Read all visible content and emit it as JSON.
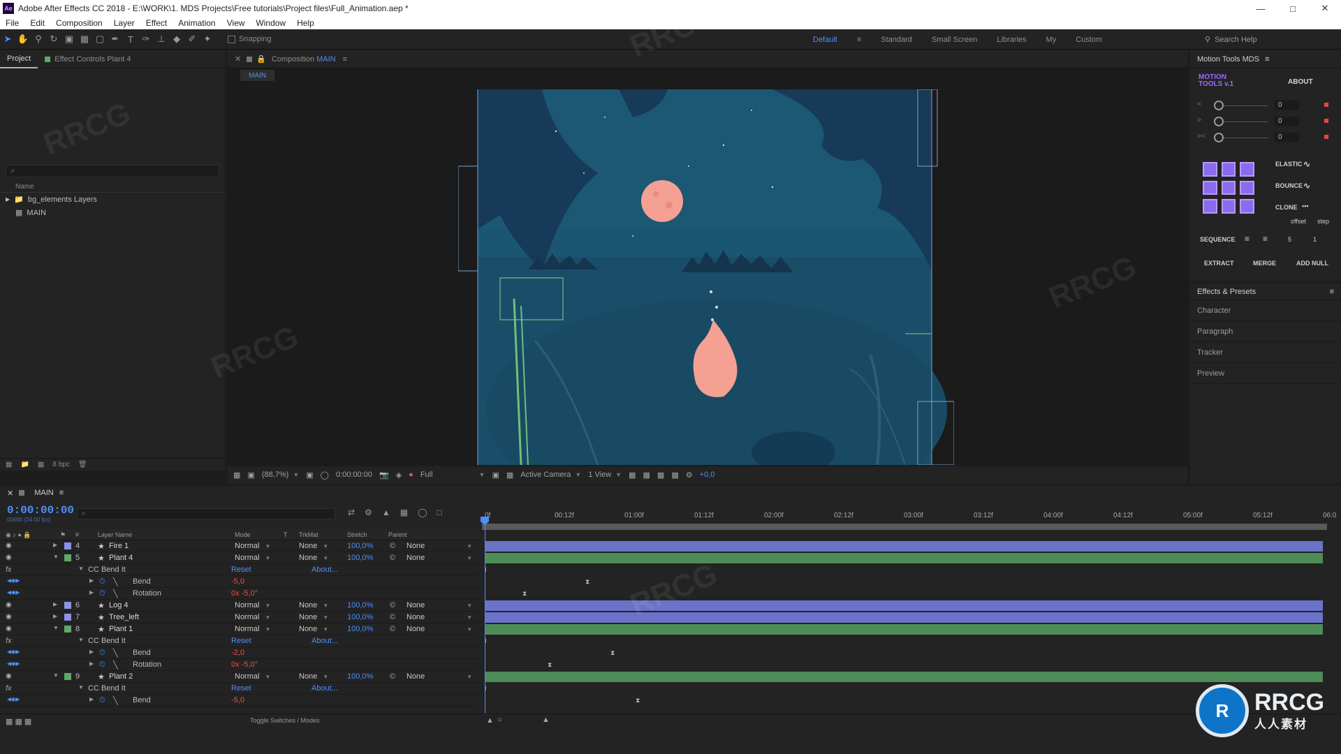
{
  "window": {
    "title": "Adobe After Effects CC 2018 - E:\\WORK\\1. MDS Projects\\Free tutorials\\Project files\\Full_Animation.aep *",
    "app_icon": "Ae"
  },
  "menu": [
    "File",
    "Edit",
    "Composition",
    "Layer",
    "Effect",
    "Animation",
    "View",
    "Window",
    "Help"
  ],
  "toolbar": {
    "snapping_label": "Snapping",
    "workspaces": [
      "Default",
      "Standard",
      "Small Screen",
      "Libraries",
      "My",
      "Custom"
    ],
    "active_workspace": "Default",
    "search_placeholder": "Search Help"
  },
  "project": {
    "tabs": [
      "Project",
      "Effect Controls Plant 4"
    ],
    "search_placeholder": "⌕",
    "column_name": "Name",
    "items": [
      {
        "label": "bg_elements Layers",
        "icon": "folder-icon"
      },
      {
        "label": "MAIN",
        "icon": "composition-icon"
      }
    ],
    "bpc": "8 bpc"
  },
  "composition": {
    "tab_label": "Composition",
    "tab_name": "MAIN",
    "subtab": "MAIN",
    "zoom": "(88,7%)",
    "timecode": "0:00:00:00",
    "resolution": "Full",
    "camera": "Active Camera",
    "views": "1 View",
    "exposure": "+0,0"
  },
  "motion_tools": {
    "title": "Motion Tools MDS",
    "logo_line1": "MOTION",
    "logo_line2": "TOOLS v.1",
    "about": "ABOUT",
    "sliders": [
      "0",
      "0",
      "0"
    ],
    "labels": {
      "elastic": "ELASTIC",
      "bounce": "BOUNCE",
      "clone": "CLONE",
      "offset": "offset",
      "step": "step",
      "sequence": "SEQUENCE",
      "seq_val1": "5",
      "seq_val2": "1"
    },
    "buttons": [
      "EXTRACT",
      "MERGE",
      "ADD NULL"
    ]
  },
  "effects_panel": {
    "title": "Effects & Presets",
    "items": [
      "Character",
      "Paragraph",
      "Tracker",
      "Preview"
    ]
  },
  "timeline": {
    "tab": "MAIN",
    "timecode": "0:00:00:00",
    "fps": "00000 (24.00 fps)",
    "search_placeholder": "⌕",
    "columns": {
      "num": "#",
      "layer_name": "Layer Name",
      "mode": "Mode",
      "t": "T",
      "trkmat": "TrkMat",
      "stretch": "Stretch",
      "parent": "Parent"
    },
    "ruler": [
      "0f",
      "00:12f",
      "01:00f",
      "01:12f",
      "02:00f",
      "02:12f",
      "03:00f",
      "03:12f",
      "04:00f",
      "04:12f",
      "05:00f",
      "05:12f",
      "06:0"
    ],
    "toggle_label": "Toggle Switches / Modes",
    "rows": [
      {
        "kind": "layer",
        "num": "4",
        "name": "Fire 1",
        "mode": "Normal",
        "trk": "None",
        "stretch": "100,0%",
        "parent": "None",
        "color": "#8c92e8",
        "bar": "#6a73c8",
        "open": false
      },
      {
        "kind": "layer",
        "num": "5",
        "name": "Plant 4",
        "mode": "Normal",
        "trk": "None",
        "stretch": "100,0%",
        "parent": "None",
        "color": "#5fa868",
        "bar": "#4e8c58",
        "open": true
      },
      {
        "kind": "effect",
        "name": "CC Bend It",
        "reset": "Reset",
        "about": "About..."
      },
      {
        "kind": "prop",
        "name": "Bend",
        "value": "-5,0",
        "kf": 0.12
      },
      {
        "kind": "prop",
        "name": "Rotation",
        "value": "0x -5,0°",
        "kf": 0.045
      },
      {
        "kind": "layer",
        "num": "6",
        "name": "Log 4",
        "mode": "Normal",
        "trk": "None",
        "stretch": "100,0%",
        "parent": "None",
        "color": "#8c92e8",
        "bar": "#6a73c8",
        "open": false
      },
      {
        "kind": "layer",
        "num": "7",
        "name": "Tree_left",
        "mode": "Normal",
        "trk": "None",
        "stretch": "100,0%",
        "parent": "None",
        "color": "#8c92e8",
        "bar": "#6a73c8",
        "open": false
      },
      {
        "kind": "layer",
        "num": "8",
        "name": "Plant 1",
        "mode": "Normal",
        "trk": "None",
        "stretch": "100,0%",
        "parent": "None",
        "color": "#5fa868",
        "bar": "#4e8c58",
        "open": true
      },
      {
        "kind": "effect",
        "name": "CC Bend It",
        "reset": "Reset",
        "about": "About..."
      },
      {
        "kind": "prop",
        "name": "Bend",
        "value": "-2,0",
        "kf": 0.15
      },
      {
        "kind": "prop",
        "name": "Rotation",
        "value": "0x -5,0°",
        "kf": 0.075
      },
      {
        "kind": "layer",
        "num": "9",
        "name": "Plant 2",
        "mode": "Normal",
        "trk": "None",
        "stretch": "100,0%",
        "parent": "None",
        "color": "#5fa868",
        "bar": "#4e8c58",
        "open": true
      },
      {
        "kind": "effect",
        "name": "CC Bend It",
        "reset": "Reset",
        "about": "About..."
      },
      {
        "kind": "prop",
        "name": "Bend",
        "value": "-5,0",
        "kf": 0.18
      }
    ]
  },
  "brand": {
    "line1": "RRCG",
    "line2": "人人素材",
    "logo": "R"
  },
  "watermark": "RRCG"
}
